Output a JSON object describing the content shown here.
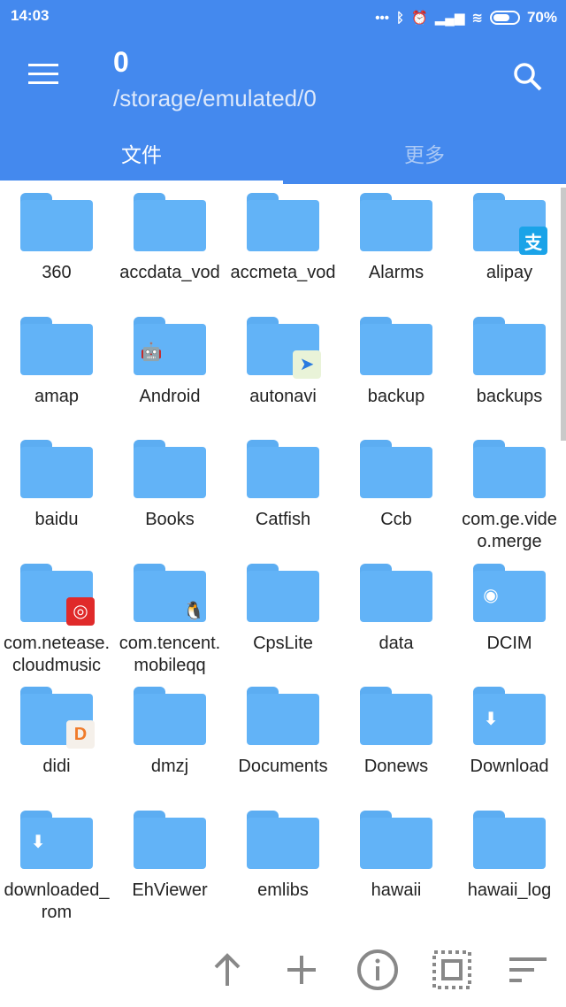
{
  "status": {
    "time": "14:03",
    "battery": "70%",
    "icons": [
      "more-dots-icon",
      "bluetooth-icon",
      "alarm-icon",
      "signal-icon",
      "wifi-icon",
      "battery-icon"
    ]
  },
  "header": {
    "title": "0",
    "path": "/storage/emulated/0"
  },
  "tabs": [
    {
      "label": "文件",
      "active": true
    },
    {
      "label": "更多",
      "active": false
    }
  ],
  "colors": {
    "header": "#4489EE",
    "folder": "#62B3F7"
  },
  "files": [
    {
      "name": "360"
    },
    {
      "name": "accdata_vod"
    },
    {
      "name": "accmeta_vod"
    },
    {
      "name": "Alarms"
    },
    {
      "name": "alipay",
      "badge": "alipay"
    },
    {
      "name": "amap"
    },
    {
      "name": "Android",
      "badge": "android"
    },
    {
      "name": "autonavi",
      "badge": "autonavi"
    },
    {
      "name": "backup"
    },
    {
      "name": "backups"
    },
    {
      "name": "baidu"
    },
    {
      "name": "Books"
    },
    {
      "name": "Catfish"
    },
    {
      "name": "Ccb"
    },
    {
      "name": "com.ge.video.merge"
    },
    {
      "name": "com.netease.cloudmusic",
      "badge": "netease"
    },
    {
      "name": "com.tencent.mobileqq",
      "badge": "qq"
    },
    {
      "name": "CpsLite"
    },
    {
      "name": "data"
    },
    {
      "name": "DCIM",
      "badge": "camera"
    },
    {
      "name": "didi",
      "badge": "didi"
    },
    {
      "name": "dmzj"
    },
    {
      "name": "Documents"
    },
    {
      "name": "Donews"
    },
    {
      "name": "Download",
      "badge": "download"
    },
    {
      "name": "downloaded_rom",
      "badge": "download"
    },
    {
      "name": "EhViewer"
    },
    {
      "name": "emlibs"
    },
    {
      "name": "hawaii"
    },
    {
      "name": "hawaii_log"
    }
  ],
  "badges": {
    "alipay": "支",
    "android": "🤖",
    "autonavi": "➤",
    "netease": "◎",
    "qq": "🐧",
    "camera": "◉",
    "didi": "D",
    "download": "⬇"
  },
  "bottom_actions": [
    "up-arrow-icon",
    "add-icon",
    "info-icon",
    "select-all-icon",
    "sort-icon"
  ]
}
